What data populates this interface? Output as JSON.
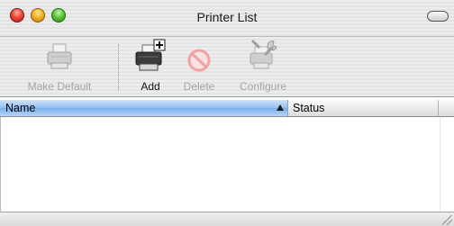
{
  "window": {
    "title": "Printer List"
  },
  "toolbar": {
    "items": [
      {
        "label": "Make Default",
        "icon": "printer-icon",
        "enabled": false
      },
      {
        "label": "Add",
        "icon": "add-printer-icon",
        "enabled": true
      },
      {
        "label": "Delete",
        "icon": "delete-icon",
        "enabled": false
      },
      {
        "label": "Configure",
        "icon": "configure-icon",
        "enabled": false
      }
    ]
  },
  "table": {
    "columns": [
      {
        "label": "Name",
        "sorted": "ascending",
        "selected": true
      },
      {
        "label": "Status",
        "sorted": null,
        "selected": false
      }
    ],
    "rows": []
  },
  "colors": {
    "header_selected": "#93bdf0",
    "title_text": "#1a1a1a"
  }
}
